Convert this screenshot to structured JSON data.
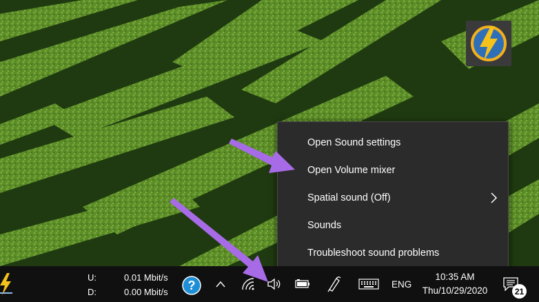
{
  "context_menu": {
    "items": [
      {
        "label": "Open Sound settings"
      },
      {
        "label": "Open Volume mixer"
      },
      {
        "label": "Spatial sound (Off)"
      },
      {
        "label": "Sounds"
      },
      {
        "label": "Troubleshoot sound problems"
      }
    ]
  },
  "taskbar": {
    "net_upload_label": "U:",
    "net_download_label": "D:",
    "net_upload_value": "0.01 Mbit/s",
    "net_download_value": "0.00 Mbit/s",
    "language": "ENG",
    "clock_time": "10:35 AM",
    "clock_date": "Thu/10/29/2020",
    "notification_count": "21"
  },
  "icons": {
    "help": "help-icon",
    "show_hidden": "chevron-up-icon",
    "wifi": "wifi-icon",
    "volume": "speaker-icon",
    "battery": "battery-icon",
    "pen": "pen-icon",
    "keyboard": "keyboard-icon",
    "notifications": "notification-icon",
    "desktop_app": "app-tile-icon"
  },
  "colors": {
    "menu_bg": "#2b2b2b",
    "taskbar_bg": "#101010",
    "arrow": "#a86be8",
    "help_badge": "#1e8fd6"
  }
}
